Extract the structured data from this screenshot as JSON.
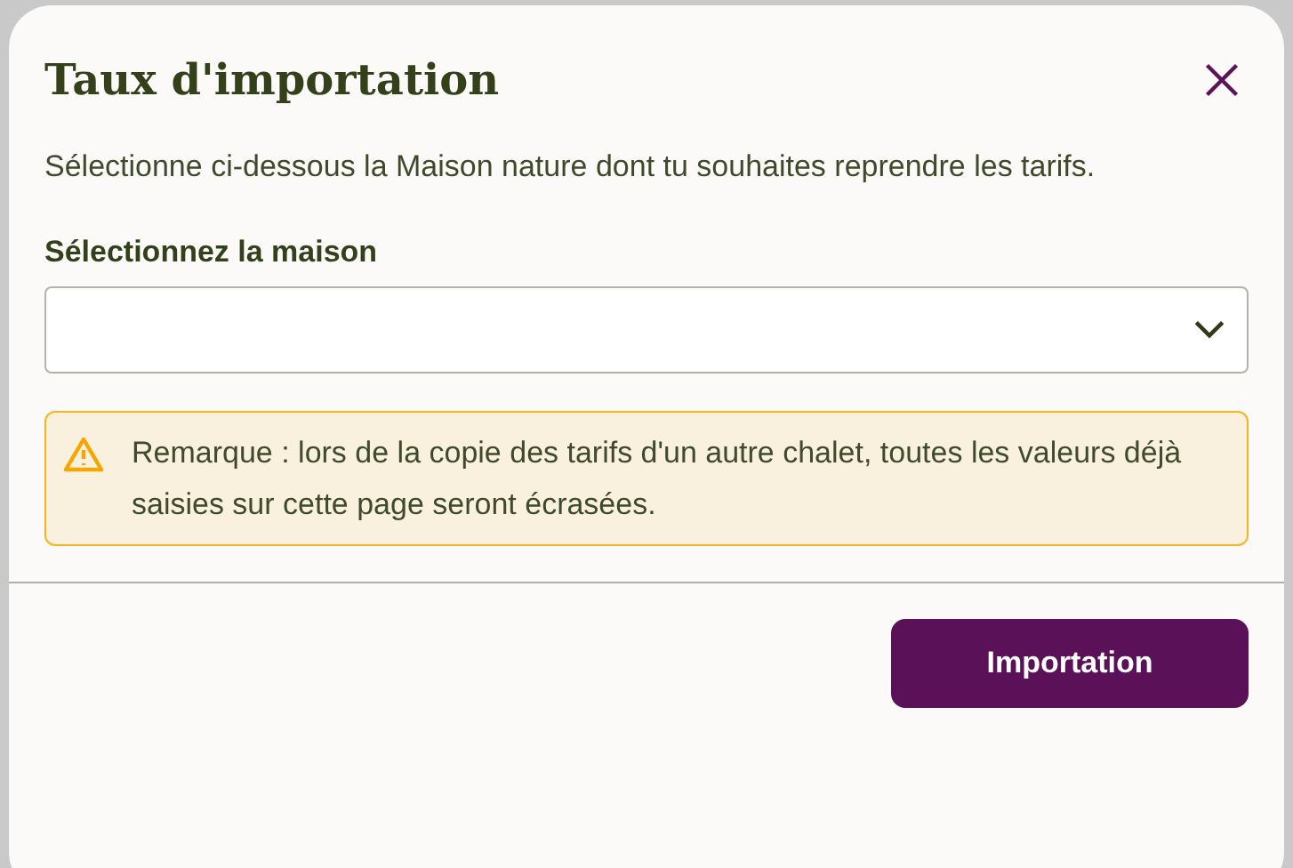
{
  "dialog": {
    "title": "Taux d'importation",
    "description": "Sélectionne ci-dessous la Maison nature dont tu souhaites reprendre les tarifs.",
    "field": {
      "label": "Sélectionnez la maison"
    },
    "notice": {
      "kind": "warning",
      "text": "Remarque : lors de la copie des tarifs d'un autre chalet, toutes les valeurs déjà saisies sur cette page seront écrasées."
    },
    "buttons": [
      "Importation"
    ]
  }
}
